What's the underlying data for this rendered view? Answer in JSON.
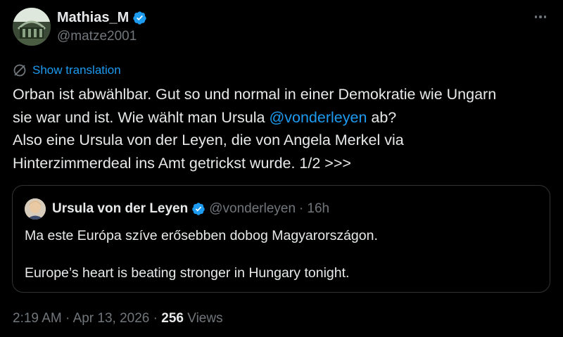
{
  "author": {
    "display_name": "Mathias_M",
    "handle": "@matze2001",
    "verified": true,
    "avatar_icon": "profile-avatar"
  },
  "translation": {
    "icon": "translate-icon",
    "label": "Show translation"
  },
  "tweet": {
    "line1": "Orban ist abwählbar. Gut so und normal in einer Demokratie wie Ungarn",
    "line2_before": "sie war und ist. Wie wählt man Ursula ",
    "line2_mention": "@vonderleyen",
    "line2_after": " ab?",
    "line3": "Also eine Ursula von der Leyen, die von Angela Merkel via",
    "line4": "Hinterzimmerdeal ins Amt getrickst wurde.  1/2 >>>"
  },
  "quote": {
    "display_name": "Ursula von der Leyen",
    "handle": "@vonderleyen",
    "separator": "·",
    "time": "16h",
    "verified": true,
    "text_hu": "Ma este Európa szíve erősebben dobog Magyarországon.",
    "text_en": "Europe’s heart is beating stronger in Hungary tonight."
  },
  "meta": {
    "time": "2:19 AM",
    "separator": " · ",
    "date": "Apr 13, 2026",
    "views_count": "256",
    "views_label": " Views"
  },
  "colors": {
    "background": "#000000",
    "text": "#e7e9ea",
    "muted": "#71767b",
    "link": "#1d9bf0",
    "border": "#2f3336",
    "verified": "#1d9bf0"
  }
}
